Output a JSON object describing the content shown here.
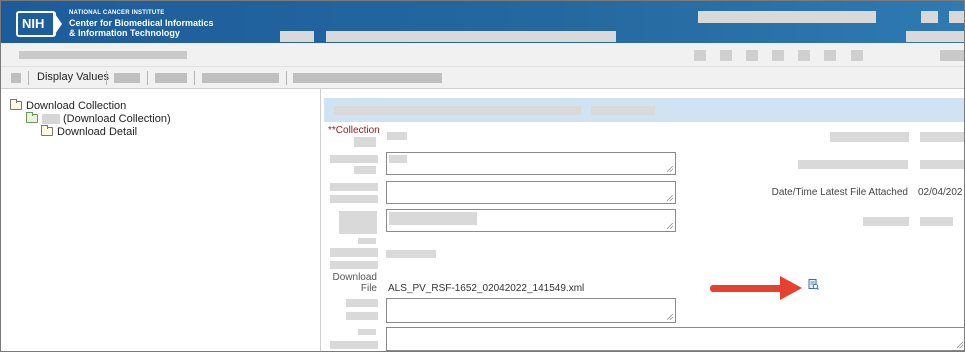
{
  "header": {
    "logo_text": "NIH",
    "org_line1": "NATIONAL CANCER INSTITUTE",
    "org_line2": "Center for Biomedical Informatics",
    "org_line3": "& Information Technology",
    "brand_color": "#1d5c9c"
  },
  "toolbar": {
    "display_values_label": "Display Values"
  },
  "tree": {
    "items": [
      {
        "label": "Download Collection",
        "level": 0,
        "icon": "folder-icon"
      },
      {
        "label": "(Download Collection)",
        "level": 1,
        "icon": "folder-tree-icon"
      },
      {
        "label": "Download Detail",
        "level": 2,
        "icon": "folder-icon"
      }
    ]
  },
  "form": {
    "collection_label": "**Collection",
    "download_file_label_line1": "Download",
    "download_file_label_line2": "File",
    "download_file_value": "ALS_PV_RSF-1652_02042022_141549.xml",
    "latest_file_label": "Date/Time Latest File Attached",
    "latest_file_value": "02/04/202",
    "required_color": "#8b1a1a",
    "annotation_arrow_color": "#e8402f",
    "download_icon": "document-download-icon"
  }
}
